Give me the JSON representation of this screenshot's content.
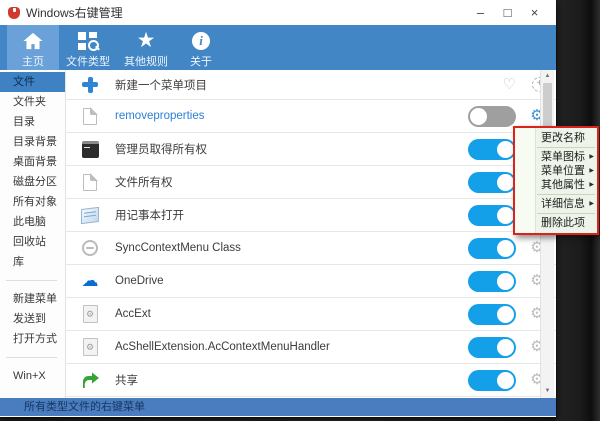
{
  "window": {
    "title": "Windows右键管理",
    "controls": {
      "minimize": "–",
      "maximize": "□",
      "close": "×"
    }
  },
  "toolbar": {
    "items": [
      {
        "label": "主页",
        "icon": "home-icon",
        "active": true
      },
      {
        "label": "文件类型",
        "icon": "file-types-icon",
        "active": false
      },
      {
        "label": "其他规则",
        "icon": "star-icon",
        "active": false
      },
      {
        "label": "关于",
        "icon": "info-icon",
        "active": false
      }
    ]
  },
  "sidebar": {
    "selected": "文件",
    "items": [
      "文件",
      "文件夹",
      "目录",
      "目录背景",
      "桌面背景",
      "磁盘分区",
      "所有对象",
      "此电脑",
      "回收站",
      "库",
      "新建菜单",
      "发送到",
      "打开方式",
      "Win+X"
    ]
  },
  "list": {
    "rows": [
      {
        "icon": "add-icon",
        "label": "新建一个菜单项目",
        "type": "add"
      },
      {
        "icon": "document-icon",
        "label": "removeproperties",
        "enabled": false,
        "custom": true
      },
      {
        "icon": "cmd-icon",
        "label": "管理员取得所有权",
        "enabled": true
      },
      {
        "icon": "document-icon",
        "label": "文件所有权",
        "enabled": true
      },
      {
        "icon": "notepad-icon",
        "label": "用记事本打开",
        "enabled": true
      },
      {
        "icon": "blocked-icon",
        "label": "SyncContextMenu Class",
        "enabled": true
      },
      {
        "icon": "onedrive-cloud-icon",
        "label": "OneDrive",
        "enabled": true
      },
      {
        "icon": "extension-icon",
        "label": "AccExt",
        "enabled": true
      },
      {
        "icon": "extension-icon",
        "label": "AcShellExtension.AcContextMenuHandler",
        "enabled": true
      },
      {
        "icon": "share-icon",
        "label": "共享",
        "enabled": true
      }
    ]
  },
  "context_menu": {
    "items": [
      {
        "label": "更改名称",
        "has_submenu": false
      },
      {
        "label": "菜单图标",
        "has_submenu": true
      },
      {
        "label": "菜单位置",
        "has_submenu": true
      },
      {
        "label": "其他属性",
        "has_submenu": true
      },
      {
        "label": "详细信息",
        "has_submenu": true
      },
      {
        "label": "删除此项",
        "has_submenu": false
      }
    ]
  },
  "statusbar": {
    "text": "所有类型文件的右键菜单"
  },
  "icons": {
    "heart": "♡",
    "plus_small": "+",
    "gear": "⚙",
    "cloud": "☁",
    "ext_gear": "⚙",
    "star": "★",
    "info_letter": "i",
    "submenu_arrow": "▶",
    "scroll_up": "▲",
    "scroll_down": "▼"
  },
  "colors": {
    "toolbar_blue": "#4286c5",
    "toolbar_active": "#69a1d8",
    "sidebar_selected": "#3e82c4",
    "toggle_on": "#14a0e9",
    "toggle_off": "#9f9f9f",
    "statusbar_blue": "#4a7dc0",
    "menu_background": "#eef4e9",
    "annotation_red": "#d8241b",
    "link_text": "#2a7fd4"
  }
}
